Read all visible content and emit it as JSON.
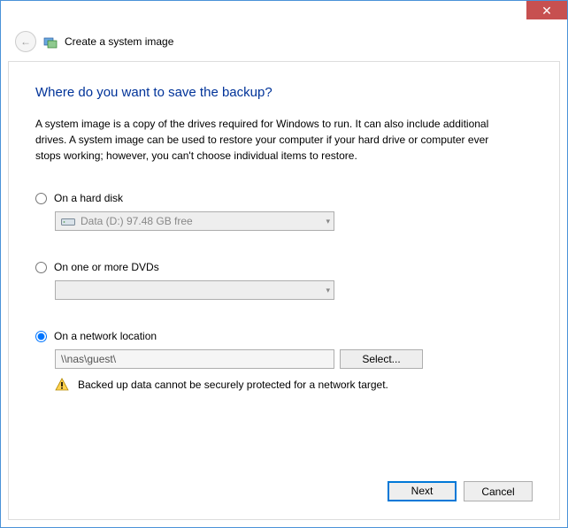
{
  "titlebar": {
    "close": "✕"
  },
  "header": {
    "title": "Create a system image"
  },
  "main": {
    "heading": "Where do you want to save the backup?",
    "description": "A system image is a copy of the drives required for Windows to run. It can also include additional drives. A system image can be used to restore your computer if your hard drive or computer ever stops working; however, you can't choose individual items to restore."
  },
  "options": {
    "hard_disk": {
      "label": "On a hard disk",
      "selected_drive": "Data (D:)  97.48 GB free",
      "checked": false
    },
    "dvd": {
      "label": "On one or more DVDs",
      "selected_drive": "",
      "checked": false
    },
    "network": {
      "label": "On a network location",
      "path": "\\\\nas\\guest\\",
      "select_button": "Select...",
      "checked": true,
      "warning": "Backed up data cannot be securely protected for a network target."
    }
  },
  "footer": {
    "next": "Next",
    "cancel": "Cancel"
  }
}
